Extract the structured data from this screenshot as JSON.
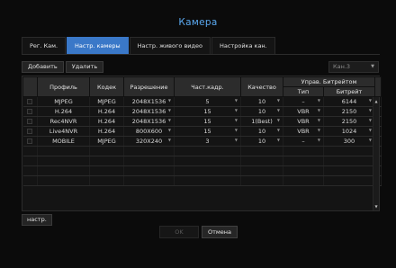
{
  "window": {
    "title": "Камера"
  },
  "tabs": [
    {
      "label": "Рег. Кам.",
      "active": false
    },
    {
      "label": "Настр. камеры",
      "active": true
    },
    {
      "label": "Настр. живого видео",
      "active": false
    },
    {
      "label": "Настройка кан.",
      "active": false
    }
  ],
  "toolbar": {
    "add_label": "Добавить",
    "delete_label": "Удалить"
  },
  "channel_select": {
    "value": "Кан.3"
  },
  "table": {
    "headers": {
      "profile": "Профиль",
      "codec": "Кодек",
      "resolution": "Разрешение",
      "fps": "Част.кадр.",
      "quality": "Качество",
      "bitrate_group": "Управ. Битрейтом",
      "type": "Тип",
      "bitrate": "Битрейт"
    },
    "rows": [
      {
        "profile": "MJPEG",
        "codec": "MJPEG",
        "resolution": "2048X1536",
        "fps": "5",
        "quality": "10",
        "type": "–",
        "bitrate": "6144"
      },
      {
        "profile": "H.264",
        "codec": "H.264",
        "resolution": "2048X1536",
        "fps": "15",
        "quality": "10",
        "type": "VBR",
        "bitrate": "2150"
      },
      {
        "profile": "Rec4NVR",
        "codec": "H.264",
        "resolution": "2048X1536",
        "fps": "15",
        "quality": "1(Best)",
        "type": "VBR",
        "bitrate": "2150"
      },
      {
        "profile": "Live4NVR",
        "codec": "H.264",
        "resolution": "800X600",
        "fps": "15",
        "quality": "10",
        "type": "VBR",
        "bitrate": "1024"
      },
      {
        "profile": "MOBILE",
        "codec": "MJPEG",
        "resolution": "320X240",
        "fps": "3",
        "quality": "10",
        "type": "–",
        "bitrate": "300"
      }
    ],
    "empty_rows": 4
  },
  "setup_button": {
    "label": "настр."
  },
  "footer": {
    "ok_label": "OK",
    "cancel_label": "Отмена"
  },
  "colors": {
    "accent": "#3a78c8",
    "title": "#5aa9f0",
    "background": "#0b0b0b"
  },
  "icons": {
    "dropdown": "triangle-down-icon",
    "scroll_up": "triangle-up-icon",
    "scroll_down": "triangle-down-icon"
  }
}
